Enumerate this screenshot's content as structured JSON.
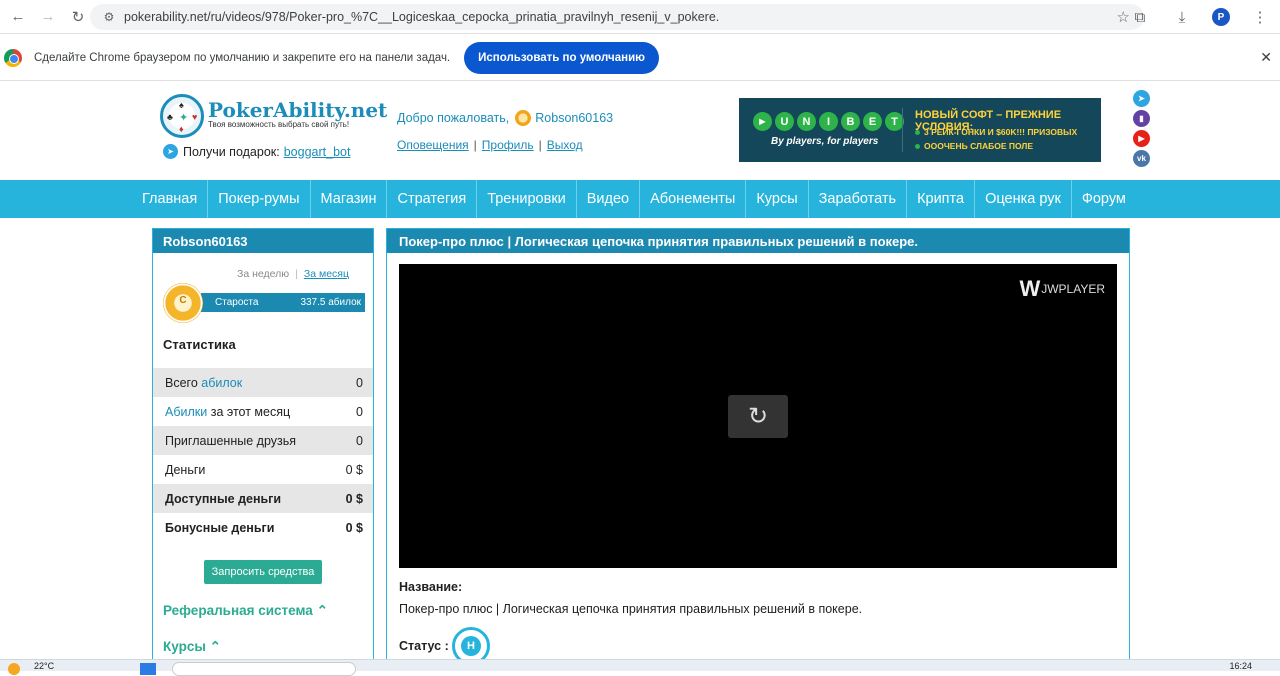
{
  "browser": {
    "url": "pokerability.net/ru/videos/978/Poker-pro_%7C__Logiceskaa_cepocka_prinatia_pravilnyh_resenij_v_pokere.",
    "profile_initial": "P",
    "infobar_message": "Сделайте Chrome браузером по умолчанию и закрепите его на панели задач.",
    "infobar_button": "Использовать по умолчанию"
  },
  "header": {
    "logo_title": "PokerAbility.net",
    "logo_subtitle": "Твоя возможность выбрать свой путь!",
    "gift_text": "Получи подарок:",
    "gift_link": "boggart_bot",
    "welcome_text": "Добро пожаловать,",
    "username": "Robson60163",
    "links": [
      "Оповещения",
      "Профиль",
      "Выход"
    ]
  },
  "banner": {
    "brand_letters": [
      "►",
      "U",
      "N",
      "I",
      "B",
      "E",
      "T"
    ],
    "tagline": "By players, for players",
    "headline": "НОВЫЙ СОФТ – ПРЕЖНИЕ УСЛОВИЯ:",
    "line1": "3 РЕЙК-ГОНКИ И $60K!!! ПРИЗОВЫХ",
    "line2": "ОООЧЕНЬ СЛАБОЕ ПОЛЕ"
  },
  "socials": [
    "telegram",
    "twitch",
    "youtube",
    "vk"
  ],
  "nav": [
    "Главная",
    "Покер-румы",
    "Магазин",
    "Стратегия",
    "Тренировки",
    "Видео",
    "Абонементы",
    "Курсы",
    "Заработать",
    "Крипта",
    "Оценка рук",
    "Форум"
  ],
  "sidebar": {
    "username": "Robson60163",
    "period_week": "За неделю",
    "period_month": "За месяц",
    "rank_letter": "C",
    "rank_name": "Староста",
    "rank_value": "337.5 абилок",
    "stats_title": "Статистика",
    "stats": [
      {
        "pre": "Всего ",
        "hl": "абилок",
        "post": "",
        "value": "0"
      },
      {
        "pre": "",
        "hl": "Абилки",
        "post": " за этот месяц",
        "value": "0"
      },
      {
        "pre": "Приглашенные друзья",
        "hl": "",
        "post": "",
        "value": "0"
      },
      {
        "pre": "Деньги",
        "hl": "",
        "post": "",
        "value": "0 $"
      },
      {
        "pre": "Доступные деньги",
        "hl": "",
        "post": "",
        "value": "0 $"
      },
      {
        "pre": "Бонусные деньги",
        "hl": "",
        "post": "",
        "value": "0 $"
      }
    ],
    "request_button": "Запросить средства",
    "referral": "Реферальная система",
    "courses": "Курсы"
  },
  "main": {
    "title": "Покер-про плюс | Логическая цепочка принятия правильных решений в покере.",
    "player_brand": "JWPLAYER",
    "name_label": "Название:",
    "name_value": "Покер-про плюс |  Логическая цепочка принятия правильных решений в покере.",
    "status_label": "Статус :",
    "status_letter": "Н"
  },
  "taskbar": {
    "temperature": "22°C",
    "time": "16:24"
  }
}
